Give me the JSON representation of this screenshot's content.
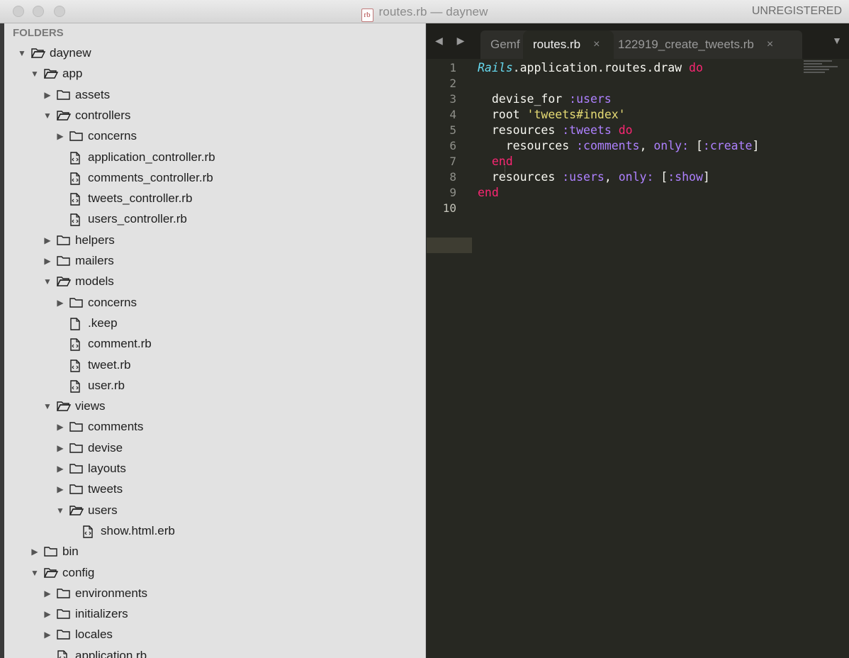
{
  "window": {
    "title": "routes.rb — daynew",
    "file_icon_text": "rb",
    "unregistered": "UNREGISTERED"
  },
  "sidebar": {
    "header": "FOLDERS",
    "tree": [
      {
        "label": "daynew",
        "level": 0,
        "kind": "folder",
        "state": "open"
      },
      {
        "label": "app",
        "level": 1,
        "kind": "folder",
        "state": "open"
      },
      {
        "label": "assets",
        "level": 2,
        "kind": "folder",
        "state": "closed"
      },
      {
        "label": "controllers",
        "level": 2,
        "kind": "folder",
        "state": "open"
      },
      {
        "label": "concerns",
        "level": 3,
        "kind": "folder",
        "state": "closed"
      },
      {
        "label": "application_controller.rb",
        "level": 3,
        "kind": "code-file"
      },
      {
        "label": "comments_controller.rb",
        "level": 3,
        "kind": "code-file"
      },
      {
        "label": "tweets_controller.rb",
        "level": 3,
        "kind": "code-file"
      },
      {
        "label": "users_controller.rb",
        "level": 3,
        "kind": "code-file"
      },
      {
        "label": "helpers",
        "level": 2,
        "kind": "folder",
        "state": "closed"
      },
      {
        "label": "mailers",
        "level": 2,
        "kind": "folder",
        "state": "closed"
      },
      {
        "label": "models",
        "level": 2,
        "kind": "folder",
        "state": "open"
      },
      {
        "label": "concerns",
        "level": 3,
        "kind": "folder",
        "state": "closed"
      },
      {
        "label": ".keep",
        "level": 3,
        "kind": "file"
      },
      {
        "label": "comment.rb",
        "level": 3,
        "kind": "code-file"
      },
      {
        "label": "tweet.rb",
        "level": 3,
        "kind": "code-file"
      },
      {
        "label": "user.rb",
        "level": 3,
        "kind": "code-file"
      },
      {
        "label": "views",
        "level": 2,
        "kind": "folder",
        "state": "open"
      },
      {
        "label": "comments",
        "level": 3,
        "kind": "folder",
        "state": "closed"
      },
      {
        "label": "devise",
        "level": 3,
        "kind": "folder",
        "state": "closed"
      },
      {
        "label": "layouts",
        "level": 3,
        "kind": "folder",
        "state": "closed"
      },
      {
        "label": "tweets",
        "level": 3,
        "kind": "folder",
        "state": "closed"
      },
      {
        "label": "users",
        "level": 3,
        "kind": "folder",
        "state": "open"
      },
      {
        "label": "show.html.erb",
        "level": 4,
        "kind": "code-file"
      },
      {
        "label": "bin",
        "level": 1,
        "kind": "folder",
        "state": "closed"
      },
      {
        "label": "config",
        "level": 1,
        "kind": "folder",
        "state": "open"
      },
      {
        "label": "environments",
        "level": 2,
        "kind": "folder",
        "state": "closed"
      },
      {
        "label": "initializers",
        "level": 2,
        "kind": "folder",
        "state": "closed"
      },
      {
        "label": "locales",
        "level": 2,
        "kind": "folder",
        "state": "closed"
      },
      {
        "label": "application.rb",
        "level": 2,
        "kind": "code-file"
      }
    ]
  },
  "tabs": [
    {
      "label": "Gemf",
      "active": false
    },
    {
      "label": "routes.rb",
      "active": true,
      "close": "×"
    },
    {
      "label": "122919_create_tweets.rb",
      "active": false,
      "close": "×"
    }
  ],
  "nav_arrows": "◀ ▶",
  "dropdown_glyph": "▼",
  "editor": {
    "line_numbers": [
      "1",
      "2",
      "3",
      "4",
      "5",
      "6",
      "7",
      "8",
      "9",
      "10"
    ],
    "current_line": 10,
    "lines": [
      [
        {
          "t": "Rails",
          "c": "#66d9ef",
          "i": true
        },
        {
          "t": ".application.routes.draw ",
          "c": "#f8f8f2"
        },
        {
          "t": "do",
          "c": "#f92672"
        }
      ],
      [],
      [
        {
          "t": "  devise_for ",
          "c": "#f8f8f2"
        },
        {
          "t": ":users",
          "c": "#ae81ff"
        }
      ],
      [
        {
          "t": "  root ",
          "c": "#f8f8f2"
        },
        {
          "t": "'tweets#index'",
          "c": "#e6db74"
        }
      ],
      [
        {
          "t": "  resources ",
          "c": "#f8f8f2"
        },
        {
          "t": ":tweets",
          "c": "#ae81ff"
        },
        {
          "t": " ",
          "c": "#f8f8f2"
        },
        {
          "t": "do",
          "c": "#f92672"
        }
      ],
      [
        {
          "t": "    resources ",
          "c": "#f8f8f2"
        },
        {
          "t": ":comments",
          "c": "#ae81ff"
        },
        {
          "t": ", ",
          "c": "#f8f8f2"
        },
        {
          "t": "only:",
          "c": "#ae81ff"
        },
        {
          "t": " [",
          "c": "#f8f8f2"
        },
        {
          "t": ":create",
          "c": "#ae81ff"
        },
        {
          "t": "]",
          "c": "#f8f8f2"
        }
      ],
      [
        {
          "t": "  end",
          "c": "#f92672"
        }
      ],
      [
        {
          "t": "  resources ",
          "c": "#f8f8f2"
        },
        {
          "t": ":users",
          "c": "#ae81ff"
        },
        {
          "t": ", ",
          "c": "#f8f8f2"
        },
        {
          "t": "only:",
          "c": "#ae81ff"
        },
        {
          "t": " [",
          "c": "#f8f8f2"
        },
        {
          "t": ":show",
          "c": "#ae81ff"
        },
        {
          "t": "]",
          "c": "#f8f8f2"
        }
      ],
      [
        {
          "t": "end",
          "c": "#f92672"
        }
      ],
      []
    ]
  },
  "colors": {
    "editor_bg": "#272822",
    "keyword": "#f92672",
    "symbol": "#ae81ff",
    "string": "#e6db74",
    "constant": "#66d9ef"
  }
}
